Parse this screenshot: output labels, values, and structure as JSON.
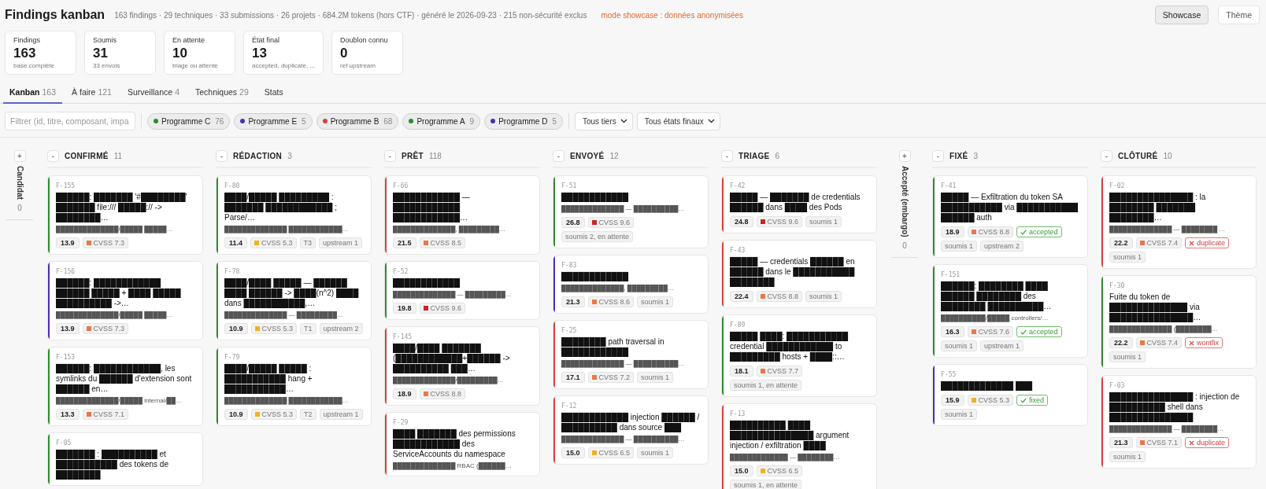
{
  "header": {
    "title": "Findings kanban",
    "meta": "163 findings · 29 techniques · 33 submissions · 26 projets · 684.2M tokens (hors CTF) · généré le 2026-09-23 · 215 non-sécurité exclus",
    "notice": "mode showcase : données anonymisées",
    "buttons": [
      {
        "label": "Showcase",
        "selected": true
      },
      {
        "label": "Thème",
        "selected": false
      }
    ]
  },
  "stats": [
    {
      "label": "Findings",
      "value": "163",
      "note": "base complète"
    },
    {
      "label": "Soumis",
      "value": "31",
      "note": "33 envois"
    },
    {
      "label": "En attente",
      "value": "10",
      "note": "triage ou attente"
    },
    {
      "label": "État final",
      "value": "13",
      "note": "accepted, duplicate, ..."
    },
    {
      "label": "Doublon connu",
      "value": "0",
      "note": "ref upstream"
    }
  ],
  "tabs": [
    {
      "label": "Kanban",
      "count": "163",
      "selected": true
    },
    {
      "label": "À faire",
      "count": "121",
      "selected": false
    },
    {
      "label": "Surveillance",
      "count": "4",
      "selected": false
    },
    {
      "label": "Techniques",
      "count": "29",
      "selected": false
    },
    {
      "label": "Stats",
      "selected": false
    }
  ],
  "filters": {
    "search": {
      "placeholder": "Filtrer (id, titre, composant, impa"
    },
    "programs": [
      {
        "label": "Programme C",
        "count": "76",
        "color": "#2e8b2e"
      },
      {
        "label": "Programme E",
        "count": "5",
        "color": "#4b2fb0"
      },
      {
        "label": "Programme B",
        "count": "68",
        "color": "#d9403a"
      },
      {
        "label": "Programme A",
        "count": "9",
        "color": "#2e8b2e"
      },
      {
        "label": "Programme D",
        "count": "5",
        "color": "#4b2fb0"
      }
    ],
    "selects": [
      {
        "value": "Tous tiers"
      },
      {
        "value": "Tous états finaux"
      }
    ]
  },
  "columns": [
    {
      "name": "Candidat",
      "count": "0",
      "toggle": "+",
      "collapsed": true
    },
    {
      "name": "CONFIRMÉ",
      "count": "11",
      "toggle": "-",
      "collapsed": false,
      "cards": [
        {
          "id": "F-155",
          "color": "#2e8b2e",
          "title": "██████: ███████ '#████████' ███████ file:/// █████:// -> ████████…",
          "path": "██████████████/█████ █████…",
          "tags": [
            {
              "kind": "score",
              "text": "13.9"
            },
            {
              "kind": "cvss",
              "text": "CVSS 7.3",
              "color": "#e8784a"
            }
          ]
        },
        {
          "id": "F-156",
          "color": "#4b2fb0",
          "title": "██████: ████████████ ██████ █████ + ████ █████ ██████████ ->…",
          "path": "██████████████/█████ █████…",
          "tags": [
            {
              "kind": "score",
              "text": "13.9"
            },
            {
              "kind": "cvss",
              "text": "CVSS 7.3",
              "color": "#e8784a"
            }
          ]
        },
        {
          "id": "F-153",
          "color": "#2e8b2e",
          "title": "██████: ████████████, les symlinks du ██████ d'extension sont ██████ en…",
          "path": "██████████████/█████ internal/██…",
          "tags": [
            {
              "kind": "score",
              "text": "13.3"
            },
            {
              "kind": "cvss",
              "text": "CVSS 7.1",
              "color": "#e8784a"
            }
          ]
        },
        {
          "id": "F-05",
          "color": "#2e8b2e",
          "title": "███████ : ██████████ et ███████████ des tokens de ████████"
        }
      ]
    },
    {
      "name": "RÉDACTION",
      "count": "3",
      "toggle": "-",
      "collapsed": false,
      "cards": [
        {
          "id": "F-80",
          "color": "#2e8b2e",
          "title": "████/█████ █████████ : ███████ ████████████ ; Parse/…",
          "path": "██████████████ ████████████…",
          "tags": [
            {
              "kind": "score",
              "text": "11.4"
            },
            {
              "kind": "cvss",
              "text": "CVSS 5.3",
              "color": "#f0b323"
            },
            {
              "kind": "chip",
              "text": "T3"
            },
            {
              "kind": "chip",
              "text": "upstream 1"
            }
          ]
        },
        {
          "id": "F-78",
          "color": "#2e8b2e",
          "title": "████/████ █████ — ██████ ████ ██████ -> ████(n^2) ████ dans ███████████,…",
          "path": "██████████████ — █████████…",
          "tags": [
            {
              "kind": "score",
              "text": "10.9"
            },
            {
              "kind": "cvss",
              "text": "CVSS 5.3",
              "color": "#f0b323"
            },
            {
              "kind": "chip",
              "text": "T1"
            },
            {
              "kind": "chip",
              "text": "upstream 2"
            }
          ]
        },
        {
          "id": "F-79",
          "color": "#2e8b2e",
          "title": "████/█████ █████ : ███████████ hang + ███████████…",
          "path": "██████████████ ████████████…",
          "tags": [
            {
              "kind": "score",
              "text": "10.9"
            },
            {
              "kind": "cvss",
              "text": "CVSS 5.3",
              "color": "#f0b323"
            },
            {
              "kind": "chip",
              "text": "T2"
            },
            {
              "kind": "chip",
              "text": "upstream 1"
            }
          ]
        }
      ]
    },
    {
      "name": "PRÊT",
      "count": "118",
      "toggle": "-",
      "collapsed": false,
      "cards": [
        {
          "id": "F-66",
          "color": "#d9403a",
          "title": "████████████ — ████████████ ████████████…",
          "path": "██████████████, █████████…",
          "tags": [
            {
              "kind": "score",
              "text": "21.5"
            },
            {
              "kind": "cvss",
              "text": "CVSS 8.5",
              "color": "#e8784a"
            }
          ]
        },
        {
          "id": "F-52",
          "color": "#2e8b2e",
          "title": "████████████",
          "path": "██████████████ — █████████…",
          "tags": [
            {
              "kind": "score",
              "text": "19.8"
            },
            {
              "kind": "cvss",
              "text": "CVSS 9.6",
              "color": "#c62828"
            }
          ]
        },
        {
          "id": "F-145",
          "color": "#d9403a",
          "title": "████/████ ███████ (████████████+██████ -> ██████████ ███…",
          "path": "██████████████/█████████…",
          "tags": [
            {
              "kind": "score",
              "text": "18.9"
            },
            {
              "kind": "cvss",
              "text": "CVSS 8.8",
              "color": "#e8784a"
            }
          ]
        },
        {
          "id": "F-29",
          "color": "#d9403a",
          "title": "████ ███████ des permissions ████████████ des ServiceAccounts du namespace",
          "path": "██████████████ RBAC (██████…"
        }
      ]
    },
    {
      "name": "ENVOYÉ",
      "count": "12",
      "toggle": "-",
      "collapsed": false,
      "cards": [
        {
          "id": "F-51",
          "color": "#2e8b2e",
          "title": "████████████",
          "path": "██████████████ — ██████████…",
          "tags": [
            {
              "kind": "score",
              "text": "26.8"
            },
            {
              "kind": "cvss",
              "text": "CVSS 9.6",
              "color": "#c62828"
            },
            {
              "kind": "chip",
              "text": "soumis 2, en attente"
            }
          ]
        },
        {
          "id": "F-83",
          "color": "#4b2fb0",
          "title": "████████████",
          "path": "██████████████, █████████…",
          "tags": [
            {
              "kind": "score",
              "text": "21.3"
            },
            {
              "kind": "cvss",
              "text": "CVSS 8.6",
              "color": "#e8784a"
            },
            {
              "kind": "chip",
              "text": "soumis 1"
            }
          ]
        },
        {
          "id": "F-25",
          "color": "#d9403a",
          "title": "████████ path traversal in ████████████",
          "path": "██████████████ — ██████████…",
          "tags": [
            {
              "kind": "score",
              "text": "17.1"
            },
            {
              "kind": "cvss",
              "text": "CVSS 7.2",
              "color": "#e8784a"
            },
            {
              "kind": "chip",
              "text": "soumis 1"
            }
          ]
        },
        {
          "id": "F-12",
          "color": "#d9403a",
          "title": "████████████ injection ██████ / ██████████ dans source ███",
          "path": "██████████████ — ██████████…",
          "tags": [
            {
              "kind": "score",
              "text": "15.0"
            },
            {
              "kind": "cvss",
              "text": "CVSS 6.5",
              "color": "#f0b323"
            },
            {
              "kind": "chip",
              "text": "soumis 1"
            }
          ]
        }
      ]
    },
    {
      "name": "TRIAGE",
      "count": "6",
      "toggle": "-",
      "collapsed": false,
      "cards": [
        {
          "id": "F-42",
          "color": "#d9403a",
          "title": "█████ — ███████ de credentials ██████ dans ████ des Pods",
          "tags": [
            {
              "kind": "score",
              "text": "24.8"
            },
            {
              "kind": "cvss",
              "text": "CVSS 9.6",
              "color": "#c62828"
            },
            {
              "kind": "chip",
              "text": "soumis 1"
            }
          ]
        },
        {
          "id": "F-43",
          "color": "#d9403a",
          "title": "█████ — credentials ██████ en ██████ dans le ███████████ ████████",
          "tags": [
            {
              "kind": "score",
              "text": "22.4"
            },
            {
              "kind": "cvss",
              "text": "CVSS 8.8",
              "color": "#e8784a"
            },
            {
              "kind": "chip",
              "text": "soumis 1"
            }
          ]
        },
        {
          "id": "F-89",
          "color": "#2e8b2e",
          "title": "█████ ████: ███████████ credential ████████████ to █████████ hosts + ████::…",
          "tags": [
            {
              "kind": "score",
              "text": "18.1"
            },
            {
              "kind": "cvss",
              "text": "CVSS 7.7",
              "color": "#e8784a"
            },
            {
              "kind": "chip",
              "text": "soumis 1, en attente"
            }
          ]
        },
        {
          "id": "F-13",
          "color": "#d9403a",
          "title": "██████████ ████ ███████████████ argument injection / exfiltration ████",
          "path": "█████████████ — ████████…",
          "tags": [
            {
              "kind": "score",
              "text": "15.0"
            },
            {
              "kind": "cvss",
              "text": "CVSS 6.5",
              "color": "#f0b323"
            },
            {
              "kind": "chip",
              "text": "soumis 1, en attente"
            }
          ]
        }
      ]
    },
    {
      "name": "Accepté (embargo)",
      "count": "0",
      "toggle": "+",
      "collapsed": true
    },
    {
      "name": "FIXÉ",
      "count": "3",
      "toggle": "-",
      "collapsed": false,
      "cards": [
        {
          "id": "F-41",
          "color": "#2e8b2e",
          "title": "█████ — Exfiltration du token SA ███████████ via ███████████ ██████ auth",
          "tags": [
            {
              "kind": "score",
              "text": "18.9"
            },
            {
              "kind": "cvss",
              "text": "CVSS 8.8",
              "color": "#e8784a"
            },
            {
              "kind": "ok",
              "text": "accepted"
            },
            {
              "kind": "chip",
              "text": "soumis 1"
            },
            {
              "kind": "chip",
              "text": "upstream 2"
            }
          ]
        },
        {
          "id": "F-151",
          "color": "#2e8b2e",
          "title": "██████: ████████ ████ ██████ ████████ des ████████ ██████████…",
          "path": "██████████/█████ controllers/…",
          "tags": [
            {
              "kind": "score",
              "text": "16.3"
            },
            {
              "kind": "cvss",
              "text": "CVSS 7.6",
              "color": "#e8784a"
            },
            {
              "kind": "ok",
              "text": "accepted"
            },
            {
              "kind": "chip",
              "text": "soumis 1"
            },
            {
              "kind": "chip",
              "text": "upstream 1"
            }
          ]
        },
        {
          "id": "F-55",
          "color": "#4b2fb0",
          "title": "█████████████ ███",
          "tags": [
            {
              "kind": "score",
              "text": "15.9"
            },
            {
              "kind": "cvss",
              "text": "CVSS 5.3",
              "color": "#f0b323"
            },
            {
              "kind": "ok",
              "text": "fixed"
            },
            {
              "kind": "chip",
              "text": "soumis 1"
            }
          ]
        }
      ]
    },
    {
      "name": "CLÔTURÉ",
      "count": "10",
      "toggle": "-",
      "collapsed": false,
      "cards": [
        {
          "id": "F-02",
          "color": "#d9403a",
          "title": "███████████████ : la ████████ ███████ ████████…",
          "path": "██████████████ — ████████ …",
          "tags": [
            {
              "kind": "score",
              "text": "22.2"
            },
            {
              "kind": "cvss",
              "text": "CVSS 7.4",
              "color": "#e8784a"
            },
            {
              "kind": "bad",
              "text": "duplicate"
            },
            {
              "kind": "chip",
              "text": "soumis 1"
            }
          ]
        },
        {
          "id": "F-30",
          "color": "#2e8b2e",
          "title": "Fuite du token de ██████████████ via ███████████████…",
          "path": "██████████████ (████████…",
          "tags": [
            {
              "kind": "score",
              "text": "22.2"
            },
            {
              "kind": "cvss",
              "text": "CVSS 7.4",
              "color": "#e8784a"
            },
            {
              "kind": "bad",
              "text": "wontfix"
            },
            {
              "kind": "chip",
              "text": "soumis 1"
            }
          ]
        },
        {
          "id": "F-03",
          "color": "#d9403a",
          "title": "███████████████ : injection de ██████████ shell dans ███████████████",
          "path": "██████████████ — ████████…",
          "tags": [
            {
              "kind": "score",
              "text": "21.3"
            },
            {
              "kind": "cvss",
              "text": "CVSS 7.1",
              "color": "#e8784a"
            },
            {
              "kind": "bad",
              "text": "duplicate"
            },
            {
              "kind": "chip",
              "text": "soumis 1"
            }
          ]
        }
      ]
    }
  ]
}
